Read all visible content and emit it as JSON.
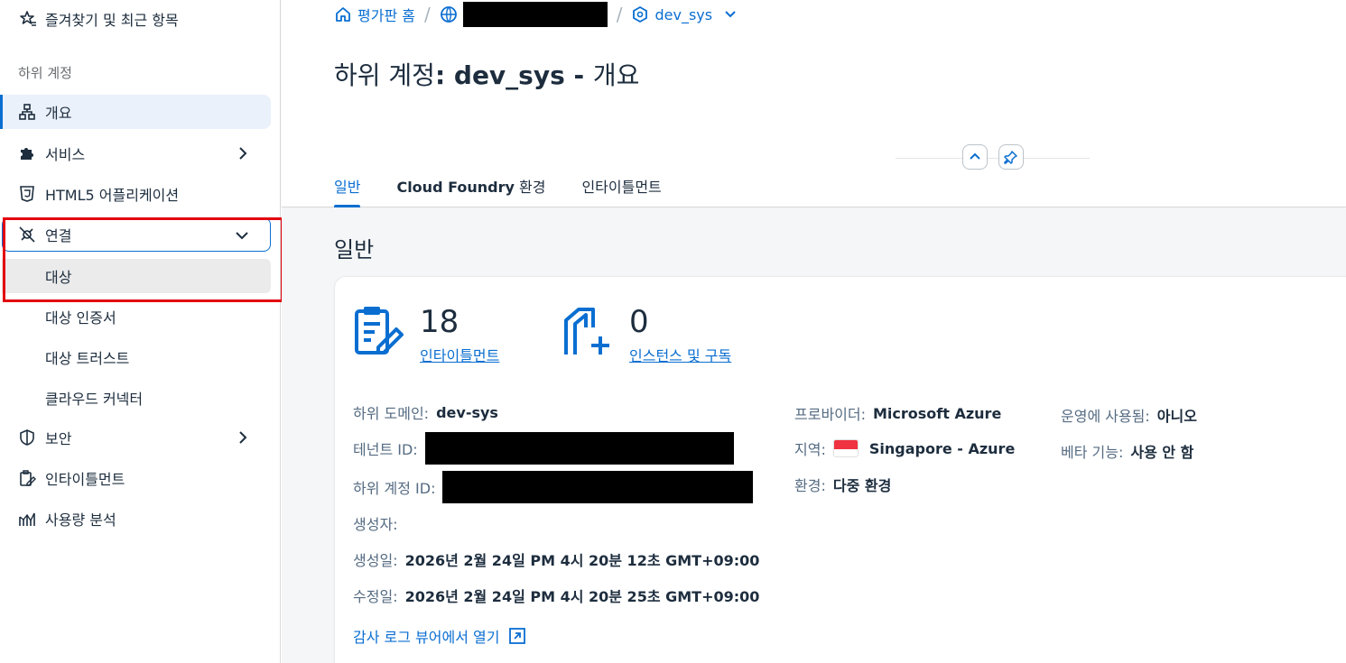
{
  "sidebar": {
    "favorites_label": "즐겨찾기 및 최근 항목",
    "section_label": "하위 계정",
    "items": [
      {
        "label": "개요",
        "icon": "hierarchy-icon"
      },
      {
        "label": "서비스",
        "icon": "puzzle-icon"
      },
      {
        "label": "HTML5 어플리케이션",
        "icon": "html5-icon"
      },
      {
        "label": "연결",
        "icon": "connection-icon"
      },
      {
        "label": "보안",
        "icon": "shield-icon"
      },
      {
        "label": "인타이틀먼트",
        "icon": "entitlement-icon"
      },
      {
        "label": "사용량 분석",
        "icon": "analytics-icon"
      }
    ],
    "connection_sub": [
      "대상",
      "대상 인증서",
      "대상 트러스트",
      "클라우드 커넥터"
    ]
  },
  "breadcrumb": {
    "home": "평가판 홈",
    "subaccount": "dev_sys"
  },
  "page_title": {
    "prefix": "하위 계정",
    "name": ": dev_sys - ",
    "suffix": "개요"
  },
  "tabs": {
    "general": "일반",
    "cf_bold": "Cloud Foundry",
    "cf_rest": " 환경",
    "entitlements": "인타이틀먼트"
  },
  "content": {
    "section_title": "일반",
    "kpis": [
      {
        "value": "18",
        "label": "인타이틀먼트"
      },
      {
        "value": "0",
        "label": "인스턴스 및 구독"
      }
    ],
    "fields": {
      "subdomain_label": "하위 도메인:",
      "subdomain_value": "dev-sys",
      "tenant_label": "테넌트 ID:",
      "subaccount_id_label": "하위 계정 ID:",
      "creator_label": "생성자:",
      "created_label": "생성일:",
      "created_value": "2026년 2월 24일 PM 4시 20분 12초 GMT+09:00",
      "modified_label": "수정일:",
      "modified_value": "2026년 2월 24일 PM 4시 20분 25초 GMT+09:00",
      "provider_label": "프로바이더:",
      "provider_value": "Microsoft Azure",
      "region_label": "지역:",
      "region_value": "Singapore - Azure",
      "environment_label": "환경:",
      "environment_value": "다중 환경",
      "production_label": "운영에 사용됨:",
      "production_value": "아니오",
      "beta_label": "베타 기능:",
      "beta_value": "사용 안 함"
    },
    "audit_link": "감사 로그 뷰어에서 열기"
  },
  "colors": {
    "accent": "#0a6ed1",
    "highlight": "#e3000f"
  }
}
